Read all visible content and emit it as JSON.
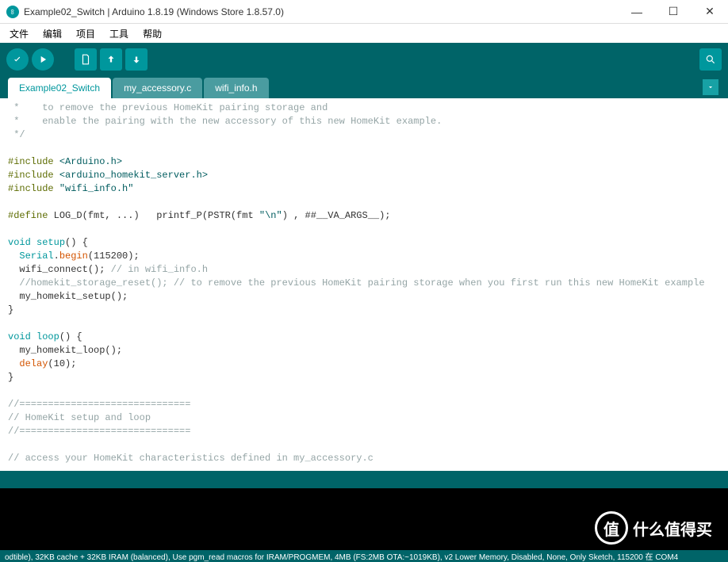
{
  "window": {
    "title": "Example02_Switch | Arduino 1.8.19 (Windows Store 1.8.57.0)"
  },
  "menu": {
    "file": "文件",
    "edit": "编辑",
    "sketch": "项目",
    "tools": "工具",
    "help": "帮助"
  },
  "tabs": {
    "t0": "Example02_Switch",
    "t1": "my_accessory.c",
    "t2": "wifi_info.h"
  },
  "code": {
    "c01a": " *    to remove the previous HomeKit pairing storage and",
    "c02a": " *    enable the pairing with the new accessory of this new HomeKit example.",
    "c03a": " */",
    "inc": "#include",
    "inc1": "<Arduino.h>",
    "inc2": "<arduino_homekit_server.h>",
    "inc3": "\"wifi_info.h\"",
    "def": "#define",
    "defbody": " LOG_D(fmt, ...)   printf_P(PSTR(fmt ",
    "defstr": "\"\\n\"",
    "defend": ") , ##__VA_ARGS__);",
    "void": "void",
    "setup": "setup",
    "loop": "loop",
    "serial": "Serial",
    "begin": "begin",
    "n115200": "115200",
    "wifi_connect": "  wifi_connect(); ",
    "wifi_connect_c": "// in wifi_info.h",
    "hsr": "  //homekit_storage_reset(); // to remove the previous HomeKit pairing storage when you first run this new HomeKit example",
    "mhs": "  my_homekit_setup();",
    "mhl": "  my_homekit_loop();",
    "delay": "delay",
    "n10": "10",
    "sep": "//==============================",
    "sepl": "// HomeKit setup and loop",
    "acc": "// access your HomeKit characteristics defined in my_accessory.c",
    "paren_open": "() {",
    "brace_close": "}"
  },
  "footer": {
    "text": "odtible), 32KB cache + 32KB IRAM (balanced), Use pgm_read macros for IRAM/PROGMEM, 4MB (FS:2MB OTA:~1019KB), v2 Lower Memory, Disabled, None, Only Sketch, 115200 在 COM4"
  },
  "watermark": {
    "char": "值",
    "text": "什么值得买"
  }
}
